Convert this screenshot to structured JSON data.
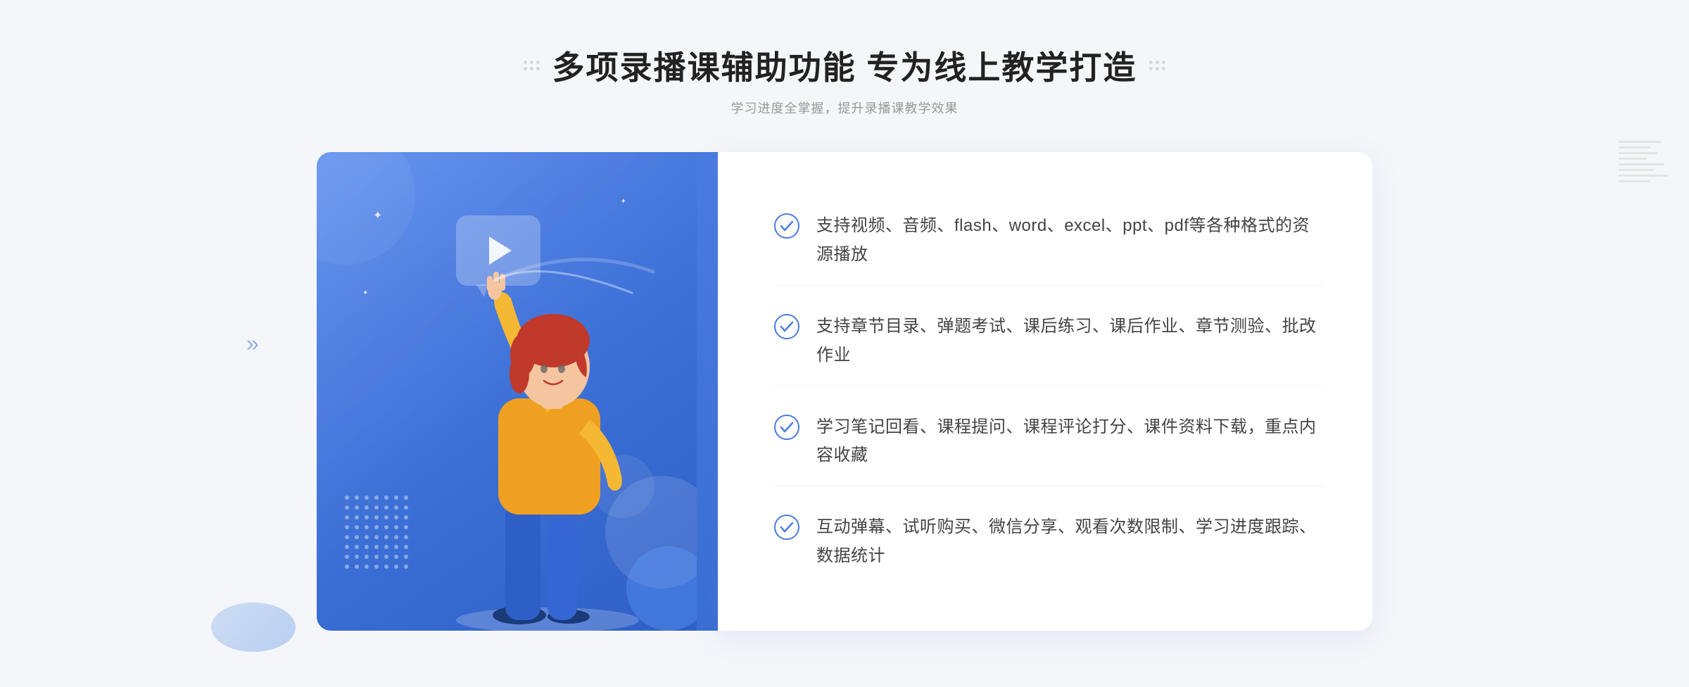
{
  "page": {
    "background": "#f5f6fa"
  },
  "header": {
    "title": "多项录播课辅助功能 专为线上教学打造",
    "subtitle": "学习进度全掌握，提升录播课教学效果",
    "deco_dots_count": 6
  },
  "features": [
    {
      "id": "feature-1",
      "text": "支持视频、音频、flash、word、excel、ppt、pdf等各种格式的资源播放"
    },
    {
      "id": "feature-2",
      "text": "支持章节目录、弹题考试、课后练习、课后作业、章节测验、批改作业"
    },
    {
      "id": "feature-3",
      "text": "学习笔记回看、课程提问、课程评论打分、课件资料下载，重点内容收藏"
    },
    {
      "id": "feature-4",
      "text": "互动弹幕、试听购买、微信分享、观看次数限制、学习进度跟踪、数据统计"
    }
  ],
  "illustration": {
    "gradient_start": "#5b8dee",
    "gradient_end": "#2e5fc7"
  },
  "icons": {
    "check": "check-circle-icon",
    "play": "play-icon",
    "chevron_left": "chevron-left-icon"
  }
}
